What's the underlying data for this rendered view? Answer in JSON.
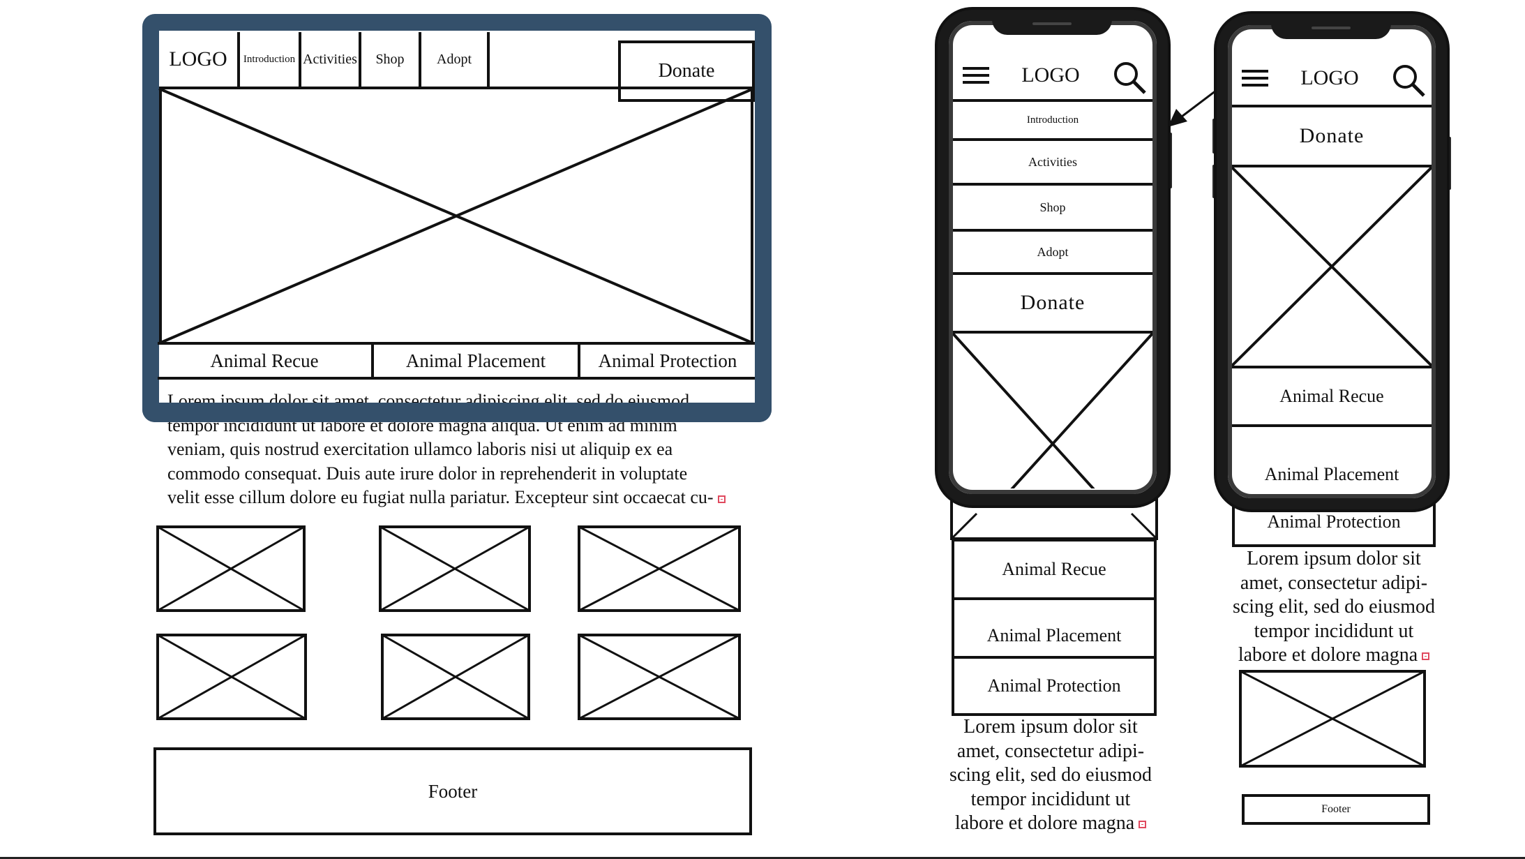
{
  "desktop": {
    "logo": "LOGO",
    "nav": [
      "Introduction",
      "Activities",
      "Shop",
      "Adopt"
    ],
    "donate": "Donate",
    "sections": [
      "Animal Recue",
      "Animal Placement",
      "Animal Protection"
    ],
    "lorem_lines": [
      "Lorem ipsum dolor sit amet, consectetur adipiscing elit, sed do eiusmod",
      "tempor incididunt ut labore et dolore magna aliqua. Ut enim ad minim",
      "veniam, quis nostrud exercitation ullamco laboris nisi ut aliquip ex ea",
      "commodo consequat. Duis aute irure dolor in reprehenderit in voluptate",
      "velit esse cillum dolore eu fugiat nulla pariatur. Excepteur sint occaecat cu-"
    ],
    "footer": "Footer",
    "frame_color": "#34506b"
  },
  "phone1": {
    "logo": "LOGO",
    "menu": [
      "Introduction",
      "Activities",
      "Shop",
      "Adopt"
    ],
    "donate": "Donate",
    "sections": [
      "Animal Recue",
      "Animal Placement",
      "Animal Protection"
    ],
    "lorem_lines": [
      "Lorem ipsum dolor sit",
      "amet, consectetur adipi-",
      "scing elit, sed do eiusmod",
      "tempor incididunt ut",
      "labore et dolore magna"
    ],
    "icons": [
      "hamburger-icon",
      "search-icon"
    ]
  },
  "phone2": {
    "logo": "LOGO",
    "donate": "Donate",
    "sections": [
      "Animal Recue",
      "Animal Placement",
      "Animal Protection"
    ],
    "lorem_lines": [
      "Lorem ipsum dolor sit",
      "amet, consectetur adipi-",
      "scing elit, sed do eiusmod",
      "tempor incididunt ut",
      "labore et dolore magna"
    ],
    "footer": "Footer",
    "icons": [
      "hamburger-icon",
      "search-icon"
    ]
  }
}
